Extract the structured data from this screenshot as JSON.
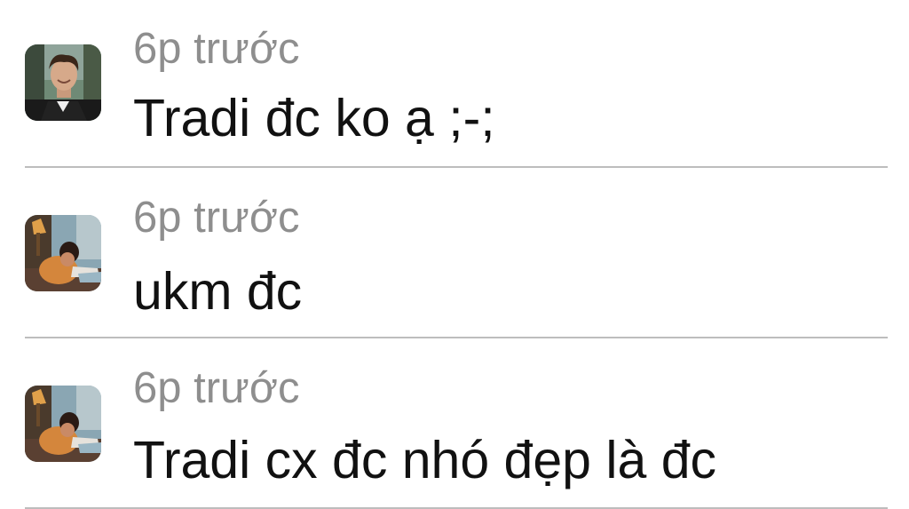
{
  "comments": [
    {
      "avatar": "user-photo-avatar",
      "time": "6p trước",
      "text": "Tradi đc ko ạ ;-;"
    },
    {
      "avatar": "user-photo-avatar",
      "time": "6p trước",
      "text": "ukm đc"
    },
    {
      "avatar": "user-photo-avatar",
      "time": "6p trước",
      "text": "Tradi cx đc nhó đẹp là đc"
    }
  ]
}
